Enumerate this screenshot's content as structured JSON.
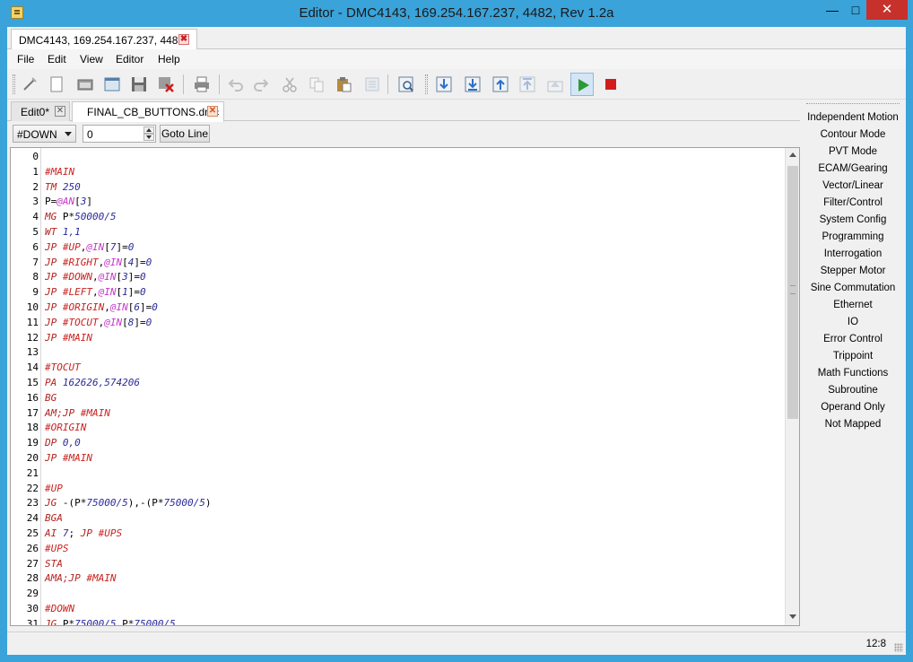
{
  "window": {
    "title": "Editor - DMC4143, 169.254.167.237, 4482, Rev 1.2a",
    "minimize": "—",
    "maximize": "□",
    "close": "✕"
  },
  "file_tab": {
    "label": "DMC4143, 169.254.167.237, 4482",
    "close": "✖"
  },
  "menu": {
    "file": "File",
    "edit": "Edit",
    "view": "View",
    "editor": "Editor",
    "help": "Help"
  },
  "toolbar_icons": [
    "new-icon",
    "new-document-icon",
    "open-folder-icon",
    "open-file-icon",
    "save-icon",
    "close-file-icon",
    "print-icon",
    "undo-icon",
    "redo-icon",
    "cut-icon",
    "copy-icon",
    "paste-icon",
    "select-all-icon",
    "find-icon",
    "download-icon",
    "download-all-icon",
    "upload-icon",
    "upload-all-icon",
    "eject-icon",
    "run-icon",
    "stop-icon"
  ],
  "editor_tabs": [
    {
      "label": "Edit0*",
      "close": "✕"
    },
    {
      "label": "FINAL_CB_BUTTONS.dmc",
      "close": "✕"
    }
  ],
  "nav": {
    "label_selected": "#DOWN",
    "line_value": "0",
    "goto_label": "Goto Line"
  },
  "code": {
    "line_numbers": [
      "0",
      "1",
      "2",
      "3",
      "4",
      "5",
      "6",
      "7",
      "8",
      "9",
      "10",
      "11",
      "12",
      "13",
      "14",
      "15",
      "16",
      "17",
      "18",
      "19",
      "20",
      "21",
      "22",
      "23",
      "24",
      "25",
      "26",
      "27",
      "28",
      "29",
      "30",
      "31"
    ],
    "lines": [
      [],
      [
        [
          "lab",
          "#MAIN"
        ]
      ],
      [
        [
          "kw",
          "TM"
        ],
        [
          "pl",
          " "
        ],
        [
          "num",
          "250"
        ]
      ],
      [
        [
          "pl",
          "P="
        ],
        [
          "fn",
          "@AN"
        ],
        [
          "pl",
          "["
        ],
        [
          "num",
          "3"
        ],
        [
          "pl",
          "]"
        ]
      ],
      [
        [
          "kw",
          "MG"
        ],
        [
          "pl",
          " P*"
        ],
        [
          "num",
          "50000/5"
        ]
      ],
      [
        [
          "kw",
          "WT"
        ],
        [
          "pl",
          " "
        ],
        [
          "num",
          "1,1"
        ]
      ],
      [
        [
          "kw",
          "JP"
        ],
        [
          "pl",
          " "
        ],
        [
          "lab",
          "#UP"
        ],
        [
          "pl",
          ","
        ],
        [
          "fn",
          "@IN"
        ],
        [
          "pl",
          "["
        ],
        [
          "num",
          "7"
        ],
        [
          "pl",
          "]="
        ],
        [
          "num",
          "0"
        ]
      ],
      [
        [
          "kw",
          "JP"
        ],
        [
          "pl",
          " "
        ],
        [
          "lab",
          "#RIGHT"
        ],
        [
          "pl",
          ","
        ],
        [
          "fn",
          "@IN"
        ],
        [
          "pl",
          "["
        ],
        [
          "num",
          "4"
        ],
        [
          "pl",
          "]="
        ],
        [
          "num",
          "0"
        ]
      ],
      [
        [
          "kw",
          "JP"
        ],
        [
          "pl",
          " "
        ],
        [
          "lab",
          "#DOWN"
        ],
        [
          "pl",
          ","
        ],
        [
          "fn",
          "@IN"
        ],
        [
          "pl",
          "["
        ],
        [
          "num",
          "3"
        ],
        [
          "pl",
          "]="
        ],
        [
          "num",
          "0"
        ]
      ],
      [
        [
          "kw",
          "JP"
        ],
        [
          "pl",
          " "
        ],
        [
          "lab",
          "#LEFT"
        ],
        [
          "pl",
          ","
        ],
        [
          "fn",
          "@IN"
        ],
        [
          "pl",
          "["
        ],
        [
          "num",
          "1"
        ],
        [
          "pl",
          "]="
        ],
        [
          "num",
          "0"
        ]
      ],
      [
        [
          "kw",
          "JP"
        ],
        [
          "pl",
          " "
        ],
        [
          "lab",
          "#ORIGIN"
        ],
        [
          "pl",
          ","
        ],
        [
          "fn",
          "@IN"
        ],
        [
          "pl",
          "["
        ],
        [
          "num",
          "6"
        ],
        [
          "pl",
          "]="
        ],
        [
          "num",
          "0"
        ]
      ],
      [
        [
          "kw",
          "JP"
        ],
        [
          "pl",
          " "
        ],
        [
          "lab",
          "#TOCUT"
        ],
        [
          "pl",
          ","
        ],
        [
          "fn",
          "@IN"
        ],
        [
          "pl",
          "["
        ],
        [
          "num",
          "8"
        ],
        [
          "pl",
          "]="
        ],
        [
          "num",
          "0"
        ]
      ],
      [
        [
          "kw",
          "JP"
        ],
        [
          "pl",
          " "
        ],
        [
          "lab",
          "#MAIN"
        ]
      ],
      [],
      [
        [
          "lab",
          "#TOCUT"
        ]
      ],
      [
        [
          "kw",
          "PA"
        ],
        [
          "pl",
          " "
        ],
        [
          "num",
          "162626,574206"
        ]
      ],
      [
        [
          "kw",
          "BG"
        ]
      ],
      [
        [
          "kw",
          "AM;JP"
        ],
        [
          "pl",
          " "
        ],
        [
          "lab",
          "#MAIN"
        ]
      ],
      [
        [
          "lab",
          "#ORIGIN"
        ]
      ],
      [
        [
          "kw",
          "DP"
        ],
        [
          "pl",
          " "
        ],
        [
          "num",
          "0,0"
        ]
      ],
      [
        [
          "kw",
          "JP"
        ],
        [
          "pl",
          " "
        ],
        [
          "lab",
          "#MAIN"
        ]
      ],
      [],
      [
        [
          "lab",
          "#UP"
        ]
      ],
      [
        [
          "kw",
          "JG"
        ],
        [
          "pl",
          " -(P*"
        ],
        [
          "num",
          "75000/5"
        ],
        [
          "pl",
          "),-(P*"
        ],
        [
          "num",
          "75000/5"
        ],
        [
          "pl",
          ")"
        ]
      ],
      [
        [
          "kw",
          "BGA"
        ]
      ],
      [
        [
          "kw",
          "AI"
        ],
        [
          "pl",
          " "
        ],
        [
          "num",
          "7"
        ],
        [
          "pl",
          "; "
        ],
        [
          "kw",
          "JP"
        ],
        [
          "pl",
          " "
        ],
        [
          "lab",
          "#UPS"
        ]
      ],
      [
        [
          "lab",
          "#UPS"
        ]
      ],
      [
        [
          "kw",
          "STA"
        ]
      ],
      [
        [
          "kw",
          "AMA;JP"
        ],
        [
          "pl",
          " "
        ],
        [
          "lab",
          "#MAIN"
        ]
      ],
      [],
      [
        [
          "lab",
          "#DOWN"
        ]
      ],
      [
        [
          "kw",
          "JG"
        ],
        [
          "pl",
          " P*"
        ],
        [
          "num",
          "75000/5"
        ],
        [
          "pl",
          ",P*"
        ],
        [
          "num",
          "75000/5"
        ]
      ]
    ]
  },
  "side_panel": {
    "items": [
      "Independent Motion",
      "Contour Mode",
      "PVT Mode",
      "ECAM/Gearing",
      "Vector/Linear",
      "Filter/Control",
      "System Config",
      "Programming",
      "Interrogation",
      "Stepper Motor",
      "Sine Commutation",
      "Ethernet",
      "IO",
      "Error Control",
      "Trippoint",
      "Math Functions",
      "Subroutine",
      "Operand Only",
      "Not Mapped"
    ]
  },
  "status": {
    "cursor_position": "12:8"
  },
  "colors": {
    "title_bar": "#3aa3d9",
    "close_button": "#c7312b",
    "keyword": "#b2231f",
    "number": "#2a2a9c",
    "function": "#c338c8"
  }
}
